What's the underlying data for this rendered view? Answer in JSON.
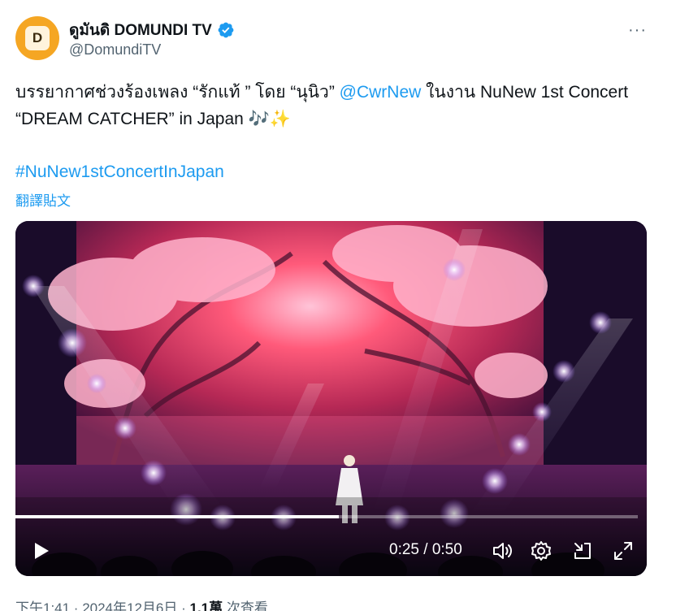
{
  "author": {
    "display_name": "ดูมันดิ DOMUNDI TV",
    "handle": "@DomundiTV",
    "avatar_glyph": "D"
  },
  "more_label": "···",
  "tweet": {
    "text_part1": "บรรยากาศช่วงร้องเพลง “รักแท้ ” โดย “นุนิว” ",
    "mention": "@CwrNew",
    "text_part2": " ในงาน NuNew 1st Concert “DREAM CATCHER” in Japan 🎶✨",
    "hashtag": "#NuNew1stConcertInJapan",
    "translate_label": "翻譯貼文"
  },
  "video": {
    "progress": 0.52,
    "time_display": "0:25 / 0:50",
    "icons": [
      "play-icon",
      "volume-icon",
      "settings-icon",
      "pip-icon",
      "fullscreen-icon"
    ]
  },
  "footer": {
    "timestamp": "下午1:41 · 2024年12月6日 · ",
    "views_count": "1.1萬",
    "views_label": " 次查看"
  },
  "colors": {
    "accent": "#1d9bf0",
    "verified": "#1d9bf0",
    "avatar_bg": "#f5a623",
    "text": "#0f1419",
    "muted": "#536471"
  }
}
